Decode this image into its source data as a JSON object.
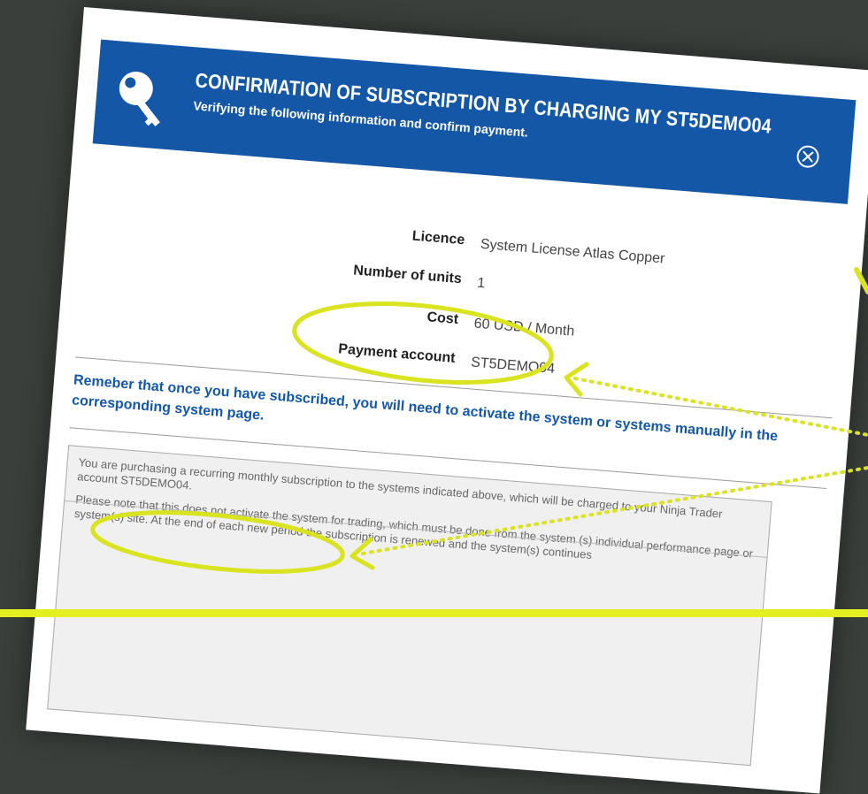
{
  "dialog": {
    "title": "CONFIRMATION OF SUBSCRIPTION BY CHARGING MY ST5DEMO04",
    "subtitle": "Verifying the following information and confirm payment."
  },
  "details": {
    "licence_label": "Licence",
    "licence_value": "System License Atlas Copper",
    "units_label": "Number of units",
    "units_value": "1",
    "cost_label": "Cost",
    "cost_value": "60 USD / Month",
    "account_label": "Payment account",
    "account_value": "ST5DEMO04"
  },
  "notice": "Remeber that once you have subscribed, you will need to activate the system or systems manually in the corresponding system page.",
  "terms": {
    "paragraph_1": "You are purchasing a recurring monthly subscription to the systems indicated above, which will be charged to your Ninja Trader account ST5DEMO04.",
    "paragraph_2": "Please note that this does not activate the system for trading, which must be done from the system (s) individual performance page or system(s) site. At the end of each new period the subscription is renewed and the system(s) continues"
  },
  "colors": {
    "brand_blue": "#1457a6",
    "highlight": "#d9e31f",
    "backdrop": "#3a3f3c"
  },
  "icons": [
    "key-icon",
    "close-icon"
  ]
}
